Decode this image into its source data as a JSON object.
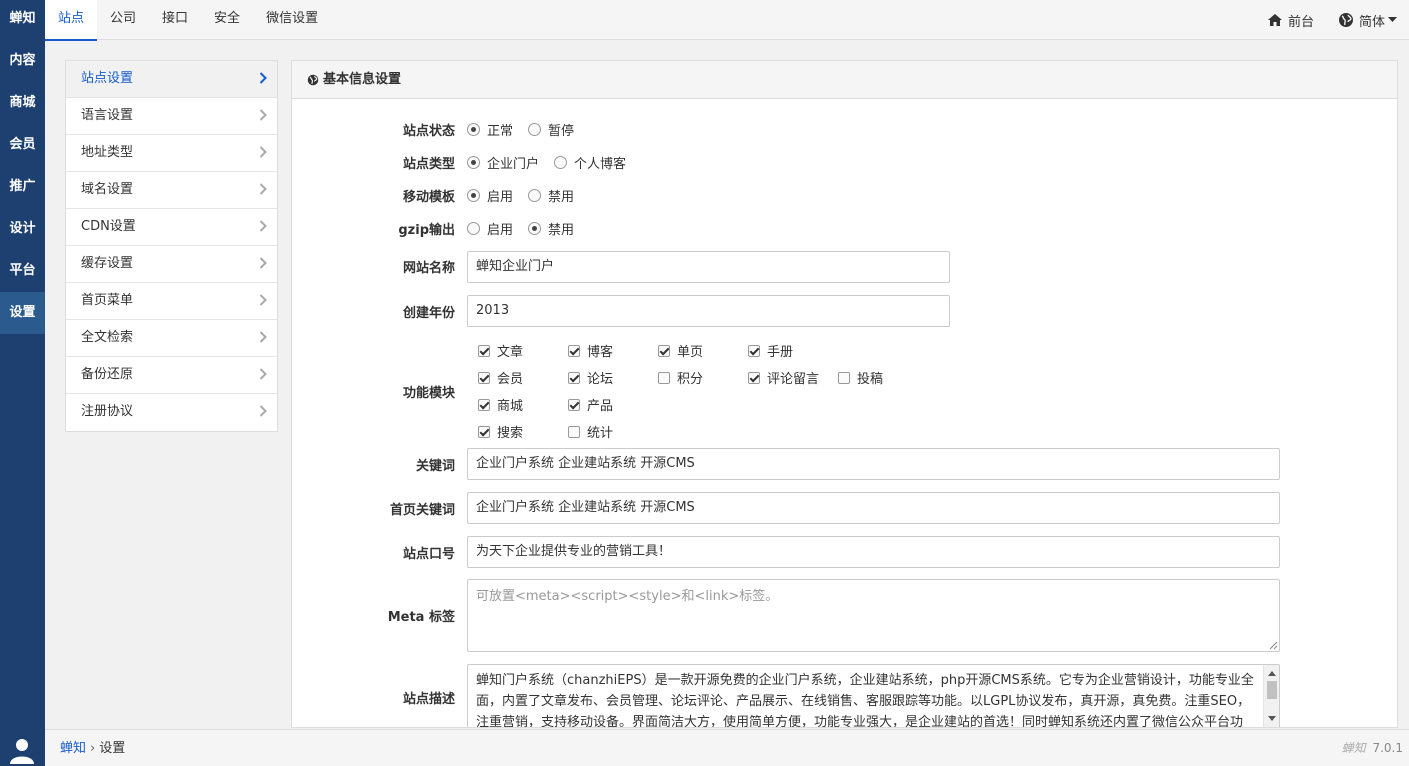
{
  "leftnav": {
    "brand": "蝉知",
    "items": [
      "内容",
      "商城",
      "会员",
      "推广",
      "设计",
      "平台",
      "设置"
    ],
    "active_index": 6
  },
  "topbar": {
    "tabs": [
      "站点",
      "公司",
      "接口",
      "安全",
      "微信设置"
    ],
    "active_index": 0,
    "frontend_label": "前台",
    "lang_label": "简体"
  },
  "submenu": {
    "items": [
      "站点设置",
      "语言设置",
      "地址类型",
      "域名设置",
      "CDN设置",
      "缓存设置",
      "首页菜单",
      "全文检索",
      "备份还原",
      "注册协议"
    ],
    "active_index": 0
  },
  "panel": {
    "title": "基本信息设置"
  },
  "form": {
    "status": {
      "label": "站点状态",
      "options": [
        "正常",
        "暂停"
      ],
      "selected": 0
    },
    "type": {
      "label": "站点类型",
      "options": [
        "企业门户",
        "个人博客"
      ],
      "selected": 0
    },
    "mobile": {
      "label": "移动模板",
      "options": [
        "启用",
        "禁用"
      ],
      "selected": 0
    },
    "gzip": {
      "label": "gzip输出",
      "options": [
        "启用",
        "禁用"
      ],
      "selected": 1
    },
    "name": {
      "label": "网站名称",
      "value": "蝉知企业门户"
    },
    "year": {
      "label": "创建年份",
      "value": "2013"
    },
    "modules": {
      "label": "功能模块",
      "rows": [
        [
          {
            "label": "文章",
            "checked": true
          },
          {
            "label": "博客",
            "checked": true
          },
          {
            "label": "单页",
            "checked": true
          },
          {
            "label": "手册",
            "checked": true
          }
        ],
        [
          {
            "label": "会员",
            "checked": true
          },
          {
            "label": "论坛",
            "checked": true
          },
          {
            "label": "积分",
            "checked": false
          },
          {
            "label": "评论留言",
            "checked": true
          },
          {
            "label": "投稿",
            "checked": false
          }
        ],
        [
          {
            "label": "商城",
            "checked": true
          },
          {
            "label": "产品",
            "checked": true
          }
        ],
        [
          {
            "label": "搜索",
            "checked": true
          },
          {
            "label": "统计",
            "checked": false
          }
        ]
      ]
    },
    "keywords": {
      "label": "关键词",
      "value": "企业门户系统 企业建站系统 开源CMS"
    },
    "index_keywords": {
      "label": "首页关键词",
      "value": "企业门户系统 企业建站系统 开源CMS"
    },
    "slogan": {
      "label": "站点口号",
      "value": "为天下企业提供专业的营销工具！"
    },
    "meta": {
      "label": "Meta 标签",
      "placeholder": "可放置<meta><script><style>和<link>标签。"
    },
    "desc": {
      "label": "站点描述",
      "value": "蝉知门户系统（chanzhiEPS）是一款开源免费的企业门户系统，企业建站系统，php开源CMS系统。它专为企业营销设计，功能专业全面，内置了文章发布、会员管理、论坛评论、产品展示、在线销售、客服跟踪等功能。以LGPL协议发布，真开源，真免费。注重SEO，注重营销，支持移动设备。界面简洁大方，使用简单方便，功能专业强大，是企业建站的首选！同时蝉知系统还内置了微信公众平台功能。"
    }
  },
  "footer": {
    "crumb_root": "蝉知",
    "crumb_sep": "›",
    "crumb_current": "设置",
    "logo_text": "蝉知",
    "version": "7.0.1"
  },
  "colors": {
    "nav_bg": "#1e4070",
    "accent": "#145ccd"
  }
}
